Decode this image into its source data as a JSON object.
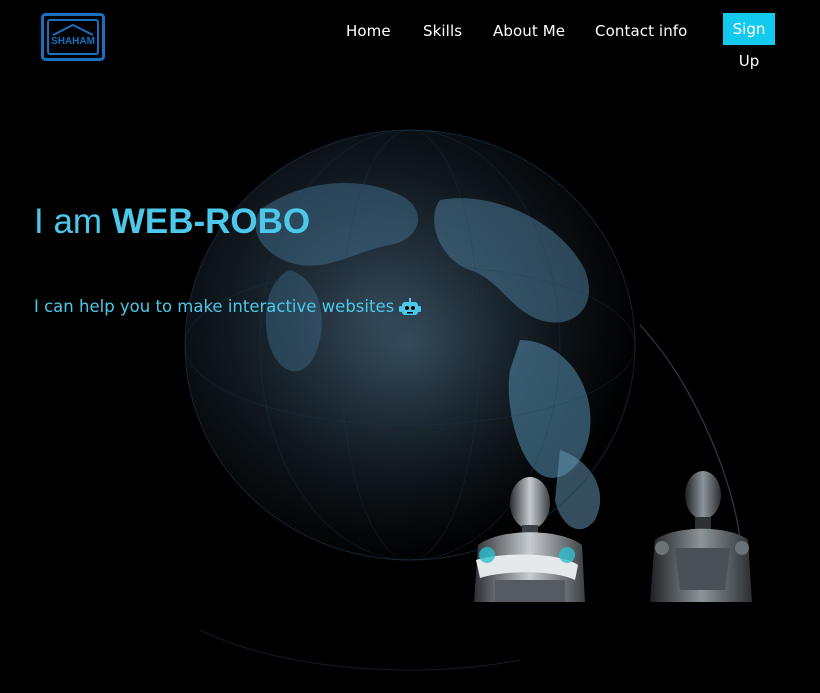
{
  "brand": {
    "logo_text": "SHAHAM"
  },
  "nav": {
    "items": [
      {
        "label": "Home"
      },
      {
        "label": "Skills"
      },
      {
        "label": "About Me"
      },
      {
        "label": "Contact info"
      }
    ],
    "signup_label": "Sign Up"
  },
  "hero": {
    "intro": "I am",
    "name": "WEB-ROBO",
    "tagline": "I can help you to make interactive websites"
  },
  "colors": {
    "accent": "#4cc9ea",
    "button": "#14c9ee",
    "background": "#000000"
  },
  "icons": [
    "robot-face-icon"
  ]
}
